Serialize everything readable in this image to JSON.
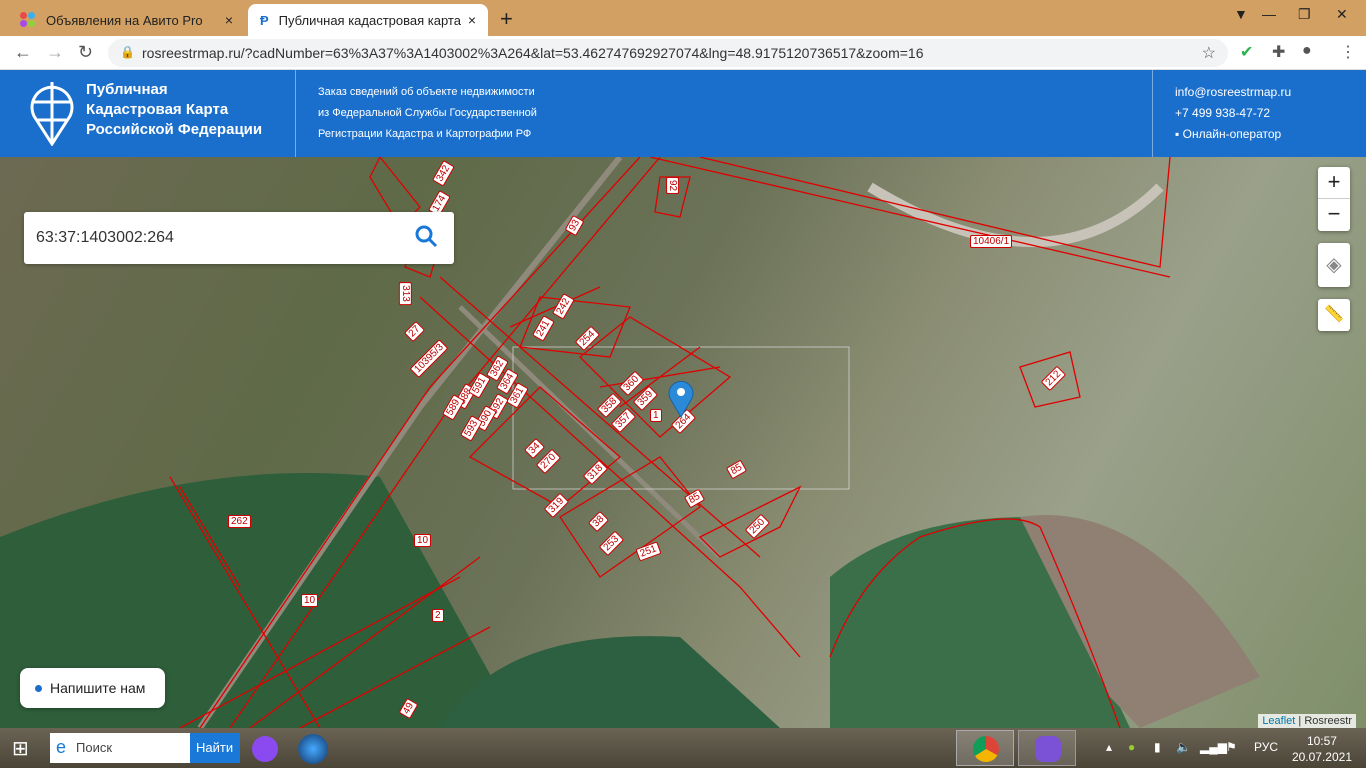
{
  "browser": {
    "tabs": [
      {
        "label": "Объявления на Авито Pro",
        "close": "×"
      },
      {
        "label": "Публичная кадастровая карта",
        "close": "×"
      }
    ],
    "new_tab": "+",
    "url": "rosreestrmap.ru/?cadNumber=63%3A37%3A1403002%3A264&lat=53.462747692927074&lng=48.9175120736517&zoom=16"
  },
  "header": {
    "brand": [
      "Публичная",
      "Кадастровая Карта",
      "Российской Федерации"
    ],
    "info": [
      "Заказ сведений об объекте недвижимости",
      "из Федеральной Службы Государственной",
      "Регистрации Кадастра и Картографии РФ"
    ],
    "email": "info@rosreestrmap.ru",
    "phone": "+7 499 938-47-72",
    "operator": "Онлайн-оператор"
  },
  "map": {
    "search_value": "63:37:1403002:264",
    "zoom_in": "+",
    "zoom_out": "−",
    "chat": "Напишите нам",
    "attribution_leaflet": "Leaflet",
    "attribution_rest": "| Rosreestr",
    "parcels": [
      "342",
      "174",
      "93",
      "92",
      "10406/1",
      "313",
      "27",
      "241",
      "242",
      "254",
      "10395/3",
      "362",
      "364",
      "361",
      "592",
      "590",
      "593",
      "588",
      "589",
      "591",
      "358",
      "360",
      "357",
      "359",
      "1",
      "264",
      "34",
      "270",
      "318",
      "85",
      "85",
      "319",
      "38",
      "253",
      "251",
      "250",
      "262",
      "10",
      "10",
      "2",
      "49",
      "212"
    ],
    "colors": {
      "parcel": "#e00000",
      "marker": "#2a8ad8",
      "header": "#1a6fcc"
    }
  },
  "taskbar": {
    "search_placeholder": "Поиск",
    "search_button": "Найти",
    "lang": "РУС",
    "time": "10:57",
    "date": "20.07.2021"
  }
}
